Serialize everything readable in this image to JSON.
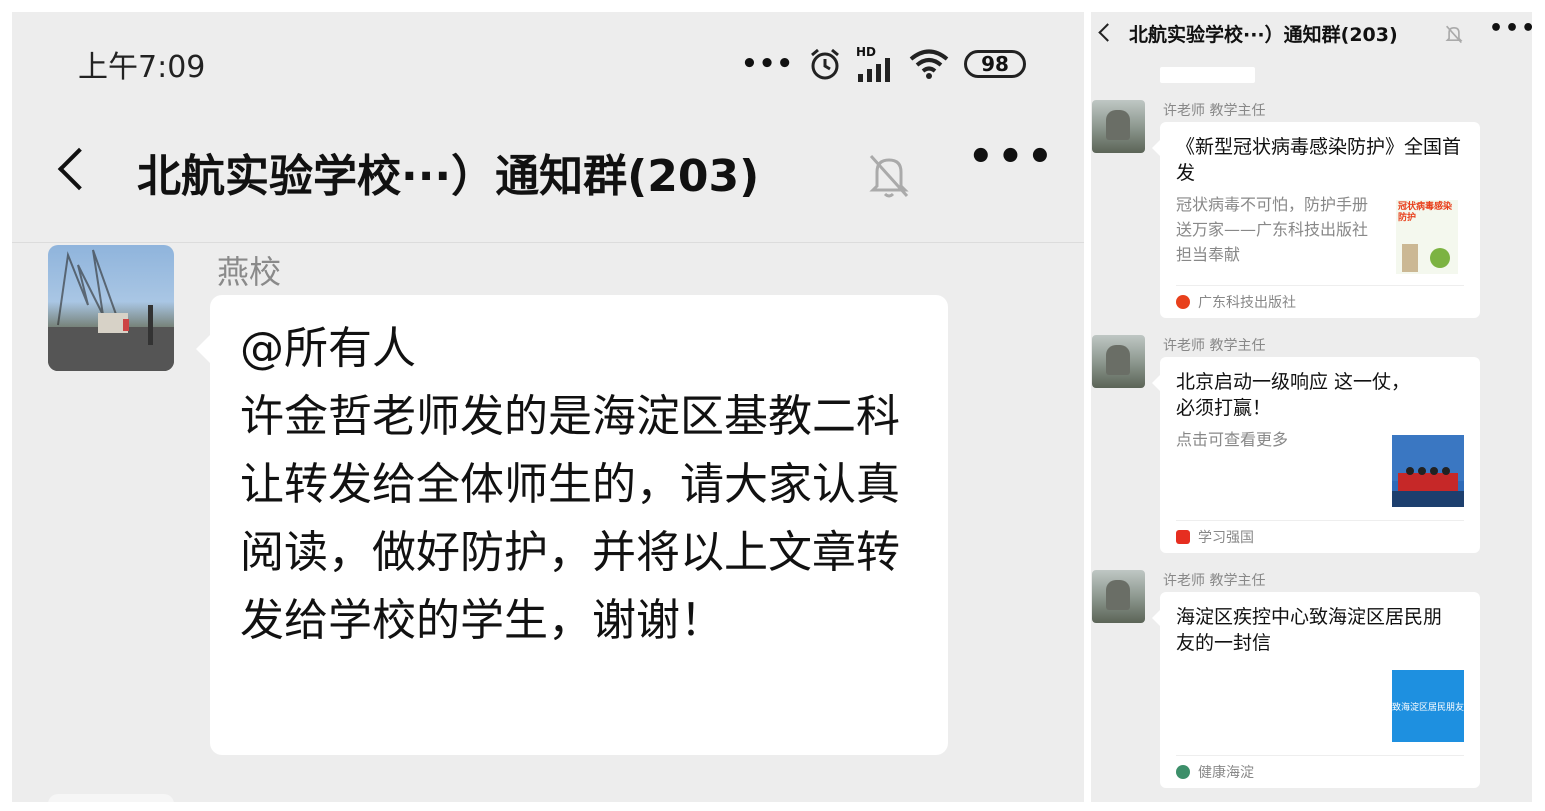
{
  "left": {
    "status": {
      "time": "上午7:09",
      "network": "HD",
      "battery": "98"
    },
    "header": {
      "title": "北航实验学校···）通知群(203)"
    },
    "message": {
      "sender": "燕校",
      "text": "@所有人\n许金哲老师发的是海淀区基教二科让转发给全体师生的，请大家认真阅读，做好防护，并将以上文章转发给学校的学生，谢谢！"
    }
  },
  "right": {
    "header": {
      "title": "北航实验学校···）通知群(203)"
    },
    "messages": [
      {
        "sender": "许老师 教学主任",
        "title": "《新型冠状病毒感染防护》全国首发",
        "desc": "冠状病毒不可怕，防护手册送万家——广东科技出版社担当奉献",
        "thumb_text": "冠状病毒感染防护",
        "source": "广东科技出版社",
        "source_color": "#e8401c"
      },
      {
        "sender": "许老师 教学主任",
        "title": "北京启动一级响应 这一仗，必须打赢！",
        "desc": "点击可查看更多",
        "source": "学习强国",
        "source_color": "#e62e20"
      },
      {
        "sender": "许老师 教学主任",
        "title": "海淀区疾控中心致海淀区居民朋友的一封信",
        "desc": "",
        "thumb_text": "致海淀区居民朋友",
        "source": "健康海淀",
        "source_color": "#3d8f6a"
      }
    ]
  }
}
